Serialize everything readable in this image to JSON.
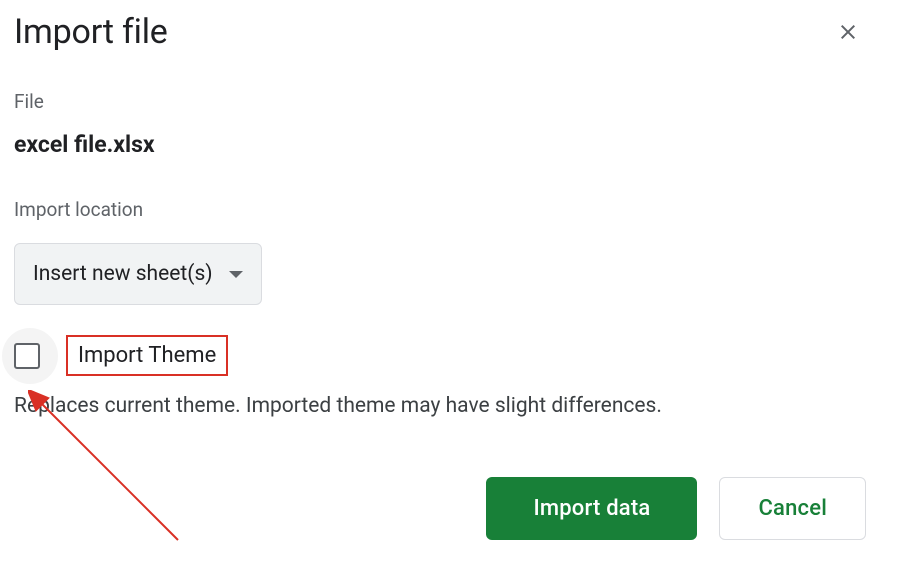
{
  "dialog": {
    "title": "Import file",
    "file_label": "File",
    "filename": "excel file.xlsx",
    "import_location_label": "Import location",
    "import_location_value": "Insert new sheet(s)",
    "import_theme_label": "Import Theme",
    "import_theme_description": "Replaces current theme. Imported theme may have slight differences.",
    "primary_button": "Import data",
    "secondary_button": "Cancel"
  }
}
